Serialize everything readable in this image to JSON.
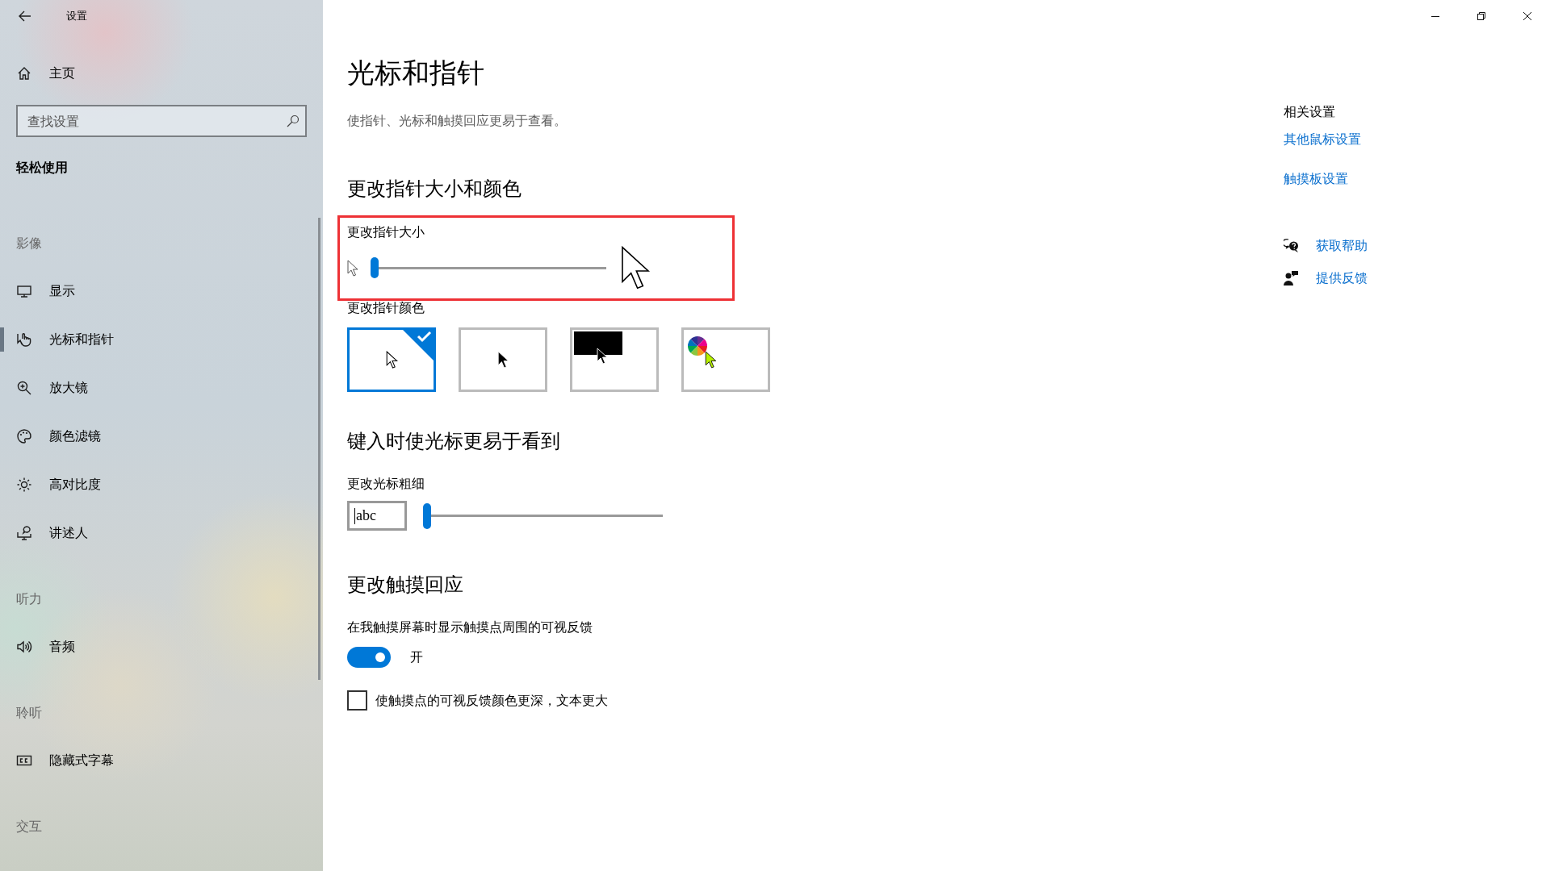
{
  "window": {
    "title": "设置"
  },
  "sidebar": {
    "home": "主页",
    "search": {
      "placeholder": "查找设置"
    },
    "category": "轻松使用",
    "groups": [
      {
        "heading": "影像",
        "items": [
          {
            "kind": "display",
            "label": "显示",
            "selected": false
          },
          {
            "kind": "pointer",
            "label": "光标和指针",
            "selected": true
          },
          {
            "kind": "magnifier",
            "label": "放大镜",
            "selected": false
          },
          {
            "kind": "palette",
            "label": "颜色滤镜",
            "selected": false
          },
          {
            "kind": "contrast",
            "label": "高对比度",
            "selected": false
          },
          {
            "kind": "narrator",
            "label": "讲述人",
            "selected": false
          }
        ]
      },
      {
        "heading": "听力",
        "items": [
          {
            "kind": "audio",
            "label": "音频",
            "selected": false
          }
        ]
      },
      {
        "heading": "聆听",
        "items": [
          {
            "kind": "captions",
            "label": "隐藏式字幕",
            "selected": false
          }
        ]
      },
      {
        "heading": "交互"
      }
    ]
  },
  "page": {
    "title": "光标和指针",
    "description": "使指针、光标和触摸回应更易于查看。",
    "pointer": {
      "heading": "更改指针大小和颜色",
      "size": {
        "label": "更改指针大小",
        "level": 0
      },
      "color_label": "更改指针颜色",
      "colors": [
        {
          "kind": "white",
          "selected": true
        },
        {
          "kind": "black",
          "selected": false
        },
        {
          "kind": "inverted",
          "selected": false
        },
        {
          "kind": "custom",
          "selected": false
        }
      ]
    },
    "text_cursor": {
      "heading": "键入时使光标更易于看到",
      "thickness_label": "更改光标粗细",
      "preview": "abc",
      "level": 0
    },
    "touch": {
      "heading": "更改触摸回应",
      "feedback_label": "在我触摸屏幕时显示触摸点周围的可视反馈",
      "toggle": {
        "on": true,
        "state_text": "开"
      },
      "darker": {
        "label": "使触摸点的可视反馈颜色更深，文本更大",
        "checked": false
      }
    }
  },
  "related": {
    "heading": "相关设置",
    "links": [
      "其他鼠标设置",
      "触摸板设置"
    ],
    "support": [
      {
        "kind": "help",
        "label": "获取帮助"
      },
      {
        "kind": "feedback",
        "label": "提供反馈"
      }
    ]
  }
}
